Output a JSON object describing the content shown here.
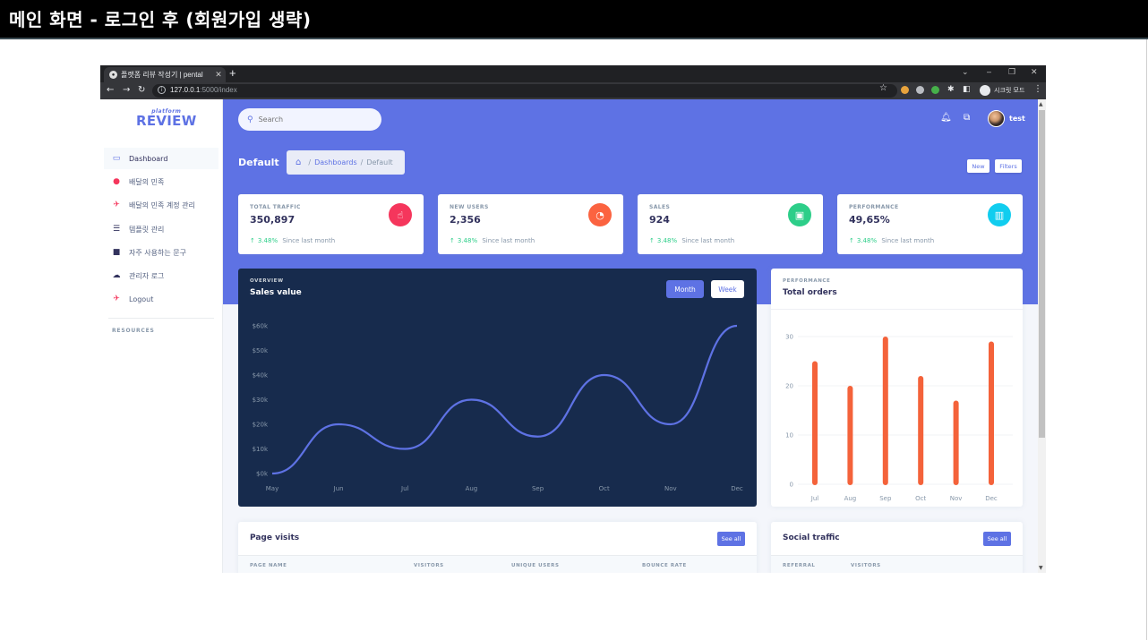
{
  "slide": {
    "title": "메인 화면 - 로그인 후 (회원가입 생략)"
  },
  "browser": {
    "tab_title": "플랫폼 리뷰 작성기 | pental",
    "url_host": "127.0.0.1",
    "url_path": ":5000/index",
    "incognito_label": "시크릿 모드"
  },
  "sidebar": {
    "logo_small": "platform",
    "logo_big": "REVIEW",
    "items": [
      {
        "label": "Dashboard",
        "icon": "monitor-icon"
      },
      {
        "label": "배달의 민족",
        "icon": "leaf-icon"
      },
      {
        "label": "배달의 민족 계정 관리",
        "icon": "runner-icon"
      },
      {
        "label": "템플릿 관리",
        "icon": "list-icon"
      },
      {
        "label": "자주 사용하는 문구",
        "icon": "folder-icon"
      },
      {
        "label": "관리자 로그",
        "icon": "cloud-icon"
      },
      {
        "label": "Logout",
        "icon": "runner-icon"
      }
    ],
    "heading": "RESOURCES"
  },
  "header": {
    "search_placeholder": "Search",
    "username": "test",
    "page_title": "Default",
    "breadcrumb": {
      "link": "Dashboards",
      "current": "Default"
    },
    "btn_new": "New",
    "btn_filters": "Filters"
  },
  "stats": [
    {
      "label": "TOTAL TRAFFIC",
      "value": "350,897",
      "change": "3.48%",
      "since": "Since last month",
      "color": "#f5365c",
      "icon": "hand-pointer-icon"
    },
    {
      "label": "NEW USERS",
      "value": "2,356",
      "change": "3.48%",
      "since": "Since last month",
      "color": "#fb6340",
      "icon": "pie-chart-icon"
    },
    {
      "label": "SALES",
      "value": "924",
      "change": "3.48%",
      "since": "Since last month",
      "color": "#2dce89",
      "icon": "money-icon"
    },
    {
      "label": "PERFORMANCE",
      "value": "49,65%",
      "change": "3.48%",
      "since": "Since last month",
      "color": "#11cdef",
      "icon": "bar-chart-icon"
    }
  ],
  "overview": {
    "pre": "OVERVIEW",
    "title": "Sales value",
    "btn_month": "Month",
    "btn_week": "Week"
  },
  "orders": {
    "pre": "PERFORMANCE",
    "title": "Total orders"
  },
  "page_visits": {
    "title": "Page visits",
    "see_all": "See all",
    "columns": [
      "PAGE NAME",
      "VISITORS",
      "UNIQUE USERS",
      "BOUNCE RATE"
    ]
  },
  "social_traffic": {
    "title": "Social traffic",
    "see_all": "See all",
    "columns": [
      "REFERRAL",
      "VISITORS"
    ]
  },
  "colors": {
    "primary": "#5e72e4",
    "dark": "#172b4d",
    "bar": "#f4623a",
    "success": "#2dce89"
  },
  "chart_data": [
    {
      "type": "line",
      "title": "Sales value",
      "categories": [
        "May",
        "Jun",
        "Jul",
        "Aug",
        "Sep",
        "Oct",
        "Nov",
        "Dec"
      ],
      "values": [
        0,
        20,
        10,
        30,
        15,
        40,
        20,
        60
      ],
      "y_ticks": [
        "$0k",
        "$10k",
        "$20k",
        "$30k",
        "$40k",
        "$50k",
        "$60k"
      ],
      "ylim": [
        0,
        60
      ],
      "line_color": "#5e72e4"
    },
    {
      "type": "bar",
      "title": "Total orders",
      "categories": [
        "Jul",
        "Aug",
        "Sep",
        "Oct",
        "Nov",
        "Dec"
      ],
      "values": [
        25,
        20,
        30,
        22,
        17,
        29
      ],
      "y_ticks": [
        "0",
        "10",
        "20",
        "30"
      ],
      "ylim": [
        0,
        30
      ],
      "bar_color": "#f4623a"
    }
  ]
}
